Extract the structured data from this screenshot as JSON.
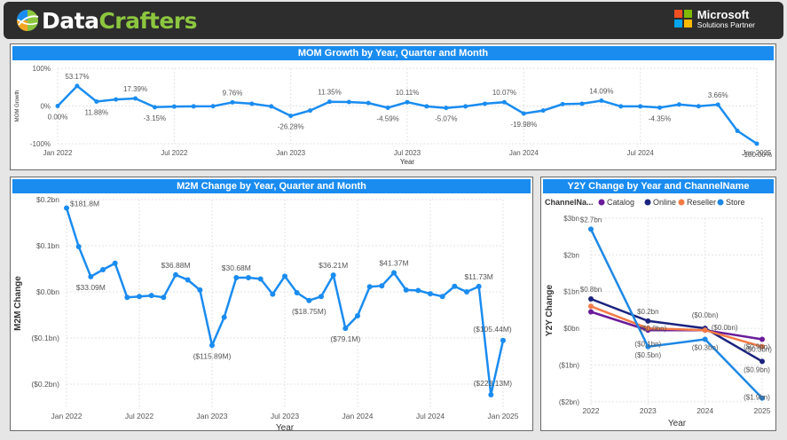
{
  "header": {
    "logo_part1": "Data",
    "logo_part2": "Crafters",
    "ms_title": "Microsoft",
    "ms_subtitle": "Solutions Partner",
    "ms_colors": [
      "#f25022",
      "#7fba00",
      "#00a4ef",
      "#ffb900"
    ]
  },
  "colors": {
    "accent": "#1a8cf0",
    "series_line": "#1a8cf0",
    "catalog": "#6a1b9a",
    "online": "#1a237e",
    "reseller": "#f47b46",
    "store": "#1e88e5"
  },
  "chart_data": [
    {
      "id": "mom",
      "type": "line",
      "title": "MOM Growth by Year, Quarter and Month",
      "xlabel": "Year",
      "ylabel": "MOM Growth",
      "ylim": [
        -100,
        100
      ],
      "yticks": [
        100,
        0,
        -100
      ],
      "ytick_labels": [
        "100%",
        "0%",
        "-100%"
      ],
      "xticks": [
        "Jan 2022",
        "Jul 2022",
        "Jan 2023",
        "Jul 2023",
        "Jan 2024",
        "Jul 2024",
        "Jan 2025"
      ],
      "values": [
        0.0,
        53.17,
        11.88,
        17.39,
        20.0,
        -3.15,
        -1.5,
        -1.0,
        -0.5,
        9.76,
        6.0,
        -1.0,
        -26.28,
        -12.0,
        11.35,
        10.5,
        8.0,
        -4.59,
        10.11,
        -1.0,
        -5.07,
        -1.0,
        6.0,
        10.07,
        -19.98,
        -12.0,
        5.0,
        6.0,
        14.09,
        -1.0,
        -1.0,
        -4.35,
        4.0,
        -0.5,
        3.66,
        -66.0,
        -100.0
      ],
      "labels": [
        {
          "i": 0,
          "text": "0.00%",
          "pos": "below"
        },
        {
          "i": 1,
          "text": "53.17%",
          "pos": "above"
        },
        {
          "i": 2,
          "text": "11.88%",
          "pos": "below"
        },
        {
          "i": 4,
          "text": "17.39%",
          "pos": "above"
        },
        {
          "i": 5,
          "text": "-3.15%",
          "pos": "below"
        },
        {
          "i": 9,
          "text": "9.76%",
          "pos": "above"
        },
        {
          "i": 12,
          "text": "-26.28%",
          "pos": "below"
        },
        {
          "i": 14,
          "text": "11.35%",
          "pos": "above"
        },
        {
          "i": 17,
          "text": "-4.59%",
          "pos": "below"
        },
        {
          "i": 18,
          "text": "10.11%",
          "pos": "above"
        },
        {
          "i": 20,
          "text": "-5.07%",
          "pos": "below"
        },
        {
          "i": 23,
          "text": "10.07%",
          "pos": "above"
        },
        {
          "i": 24,
          "text": "-19.98%",
          "pos": "below"
        },
        {
          "i": 28,
          "text": "14.09%",
          "pos": "above"
        },
        {
          "i": 31,
          "text": "-4.35%",
          "pos": "below"
        },
        {
          "i": 34,
          "text": "3.66%",
          "pos": "above"
        },
        {
          "i": 36,
          "text": "-100.00%",
          "pos": "below"
        }
      ]
    },
    {
      "id": "m2m",
      "type": "line",
      "title": "M2M Change by Year, Quarter and Month",
      "xlabel": "Year",
      "ylabel": "M2M Change",
      "ylim": [
        -0.25,
        0.2
      ],
      "yticks": [
        0.2,
        0.1,
        0.0,
        -0.1,
        -0.2
      ],
      "ytick_labels": [
        "$0.2bn",
        "$0.1bn",
        "$0.0bn",
        "($0.1bn)",
        "($0.2bn)"
      ],
      "xticks": [
        "Jan 2022",
        "Jul 2022",
        "Jan 2023",
        "Jul 2023",
        "Jan 2024",
        "Jul 2024",
        "Jan 2025"
      ],
      "values": [
        0.1818,
        0.098,
        0.033,
        0.048,
        0.062,
        -0.012,
        -0.01,
        -0.008,
        -0.012,
        0.0369,
        0.026,
        0.004,
        -0.1159,
        -0.055,
        0.0307,
        0.0307,
        0.028,
        -0.005,
        0.034,
        -0.002,
        -0.0188,
        -0.01,
        0.0362,
        -0.0791,
        -0.052,
        0.011,
        0.013,
        0.0414,
        0.004,
        0.003,
        -0.004,
        -0.01,
        0.012,
        0.0,
        0.0117,
        -0.2231,
        -0.1054
      ],
      "labels": [
        {
          "i": 0,
          "text": "$181.8M",
          "pos": "right"
        },
        {
          "i": 2,
          "text": "$33.09M",
          "pos": "below"
        },
        {
          "i": 9,
          "text": "$36.88M",
          "pos": "above"
        },
        {
          "i": 12,
          "text": "($115.89M)",
          "pos": "below"
        },
        {
          "i": 14,
          "text": "$30.68M",
          "pos": "above"
        },
        {
          "i": 20,
          "text": "($18.75M)",
          "pos": "below"
        },
        {
          "i": 22,
          "text": "$36.21M",
          "pos": "above"
        },
        {
          "i": 23,
          "text": "($79.1M)",
          "pos": "below"
        },
        {
          "i": 27,
          "text": "$41.37M",
          "pos": "above"
        },
        {
          "i": 34,
          "text": "$11.73M",
          "pos": "above"
        },
        {
          "i": 35,
          "text": "($223.13M)",
          "pos": "belowleft"
        },
        {
          "i": 36,
          "text": "($105.44M)",
          "pos": "aboveleft"
        }
      ]
    },
    {
      "id": "y2y",
      "type": "line",
      "title": "Y2Y Change by Year and ChannelName",
      "xlabel": "Year",
      "ylabel": "Y2Y Change",
      "legend_title": "ChannelNa...",
      "ylim": [
        -2.1,
        3.0
      ],
      "yticks": [
        3,
        2,
        1,
        0,
        -1,
        -2
      ],
      "ytick_labels": [
        "$3bn",
        "$2bn",
        "$1bn",
        "$0bn",
        "($1bn)",
        "($2bn)"
      ],
      "categories": [
        "2022",
        "2023",
        "2024",
        "2025"
      ],
      "series": [
        {
          "name": "Catalog",
          "color": "#6a1b9a",
          "values": [
            0.45,
            -0.05,
            -0.05,
            -0.3
          ]
        },
        {
          "name": "Online",
          "color": "#1a237e",
          "values": [
            0.8,
            0.2,
            0.0,
            -0.9
          ]
        },
        {
          "name": "Reseller",
          "color": "#f47b46",
          "values": [
            0.6,
            0.0,
            -0.05,
            -0.5
          ]
        },
        {
          "name": "Store",
          "color": "#1e88e5",
          "values": [
            2.7,
            -0.5,
            -0.3,
            -1.9
          ]
        }
      ],
      "labels": [
        {
          "text": "$2.7bn",
          "ci": 0,
          "v": 2.7,
          "dy": -8,
          "dx": 0
        },
        {
          "text": "$0.8bn",
          "ci": 0,
          "v": 0.8,
          "dy": -8,
          "dx": 0
        },
        {
          "text": "$0.2bn",
          "ci": 1,
          "v": 0.2,
          "dy": -8,
          "dx": 0
        },
        {
          "text": "($0.1bn)",
          "ci": 1,
          "v": -0.3,
          "dy": 8,
          "dx": 0
        },
        {
          "text": "($0.0bn)",
          "ci": 1,
          "v": -0.05,
          "dy": 1,
          "dx": 6
        },
        {
          "text": "($0.5bn)",
          "ci": 1,
          "v": -0.5,
          "dy": 12,
          "dx": 0
        },
        {
          "text": "($0.0bn)",
          "ci": 2,
          "v": 0.0,
          "dy": -12,
          "dx": 0
        },
        {
          "text": "($0.0bn)",
          "ci": 2,
          "v": -0.05,
          "dy": 0,
          "dx": 22
        },
        {
          "text": "($0.3bn)",
          "ci": 2,
          "v": -0.3,
          "dy": 12,
          "dx": 0
        },
        {
          "text": "($0.3bn)",
          "ci": 3,
          "v": -0.3,
          "dy": 14,
          "dx": -4
        },
        {
          "text": "($0.9bn)",
          "ci": 3,
          "v": -0.9,
          "dy": -14,
          "dx": -6
        },
        {
          "text": "($0.9bn)",
          "ci": 3,
          "v": -0.9,
          "dy": 12,
          "dx": -6
        },
        {
          "text": "($1.9bn)",
          "ci": 3,
          "v": -1.9,
          "dy": 2,
          "dx": -6
        }
      ]
    }
  ]
}
